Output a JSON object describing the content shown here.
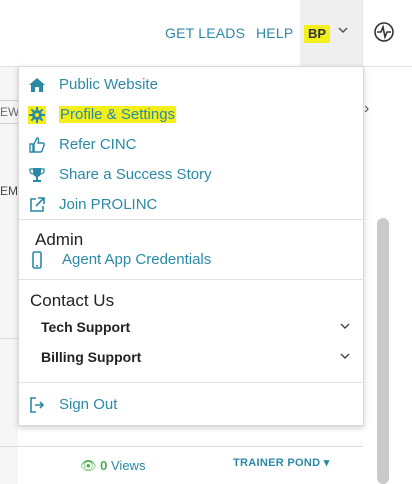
{
  "header": {
    "get_leads": "GET LEADS",
    "help": "HELP",
    "user_initials": "BP",
    "user_menu_chevron": "chevron-down-icon",
    "activity_button_icon": "pulse-icon",
    "highlight_color": "#f2ef1b",
    "link_color": "#2a8aa6"
  },
  "background": {
    "ew_label": "EW",
    "em_label": "EM",
    "views_count": "0",
    "views_label": "Views",
    "assigned_to": "TRAINER POND"
  },
  "menu": {
    "items": [
      {
        "label": "Public Website",
        "icon": "home-icon"
      },
      {
        "label": "Profile & Settings",
        "icon": "gear-icon",
        "highlighted": true
      },
      {
        "label": "Refer CINC",
        "icon": "thumbs-up-icon"
      },
      {
        "label": "Share a Success Story",
        "icon": "trophy-icon"
      },
      {
        "label": "Join PROLINC",
        "icon": "external-link-icon"
      }
    ],
    "admin": {
      "title": "Admin",
      "items": [
        {
          "label": "Agent App Credentials",
          "icon": "mobile-phone-icon"
        }
      ]
    },
    "contact": {
      "title": "Contact Us",
      "items": [
        {
          "label": "Tech Support",
          "icon": "chevron-down-icon"
        },
        {
          "label": "Billing Support",
          "icon": "chevron-down-icon"
        }
      ]
    },
    "sign_out": {
      "label": "Sign Out",
      "icon": "sign-out-icon"
    }
  }
}
